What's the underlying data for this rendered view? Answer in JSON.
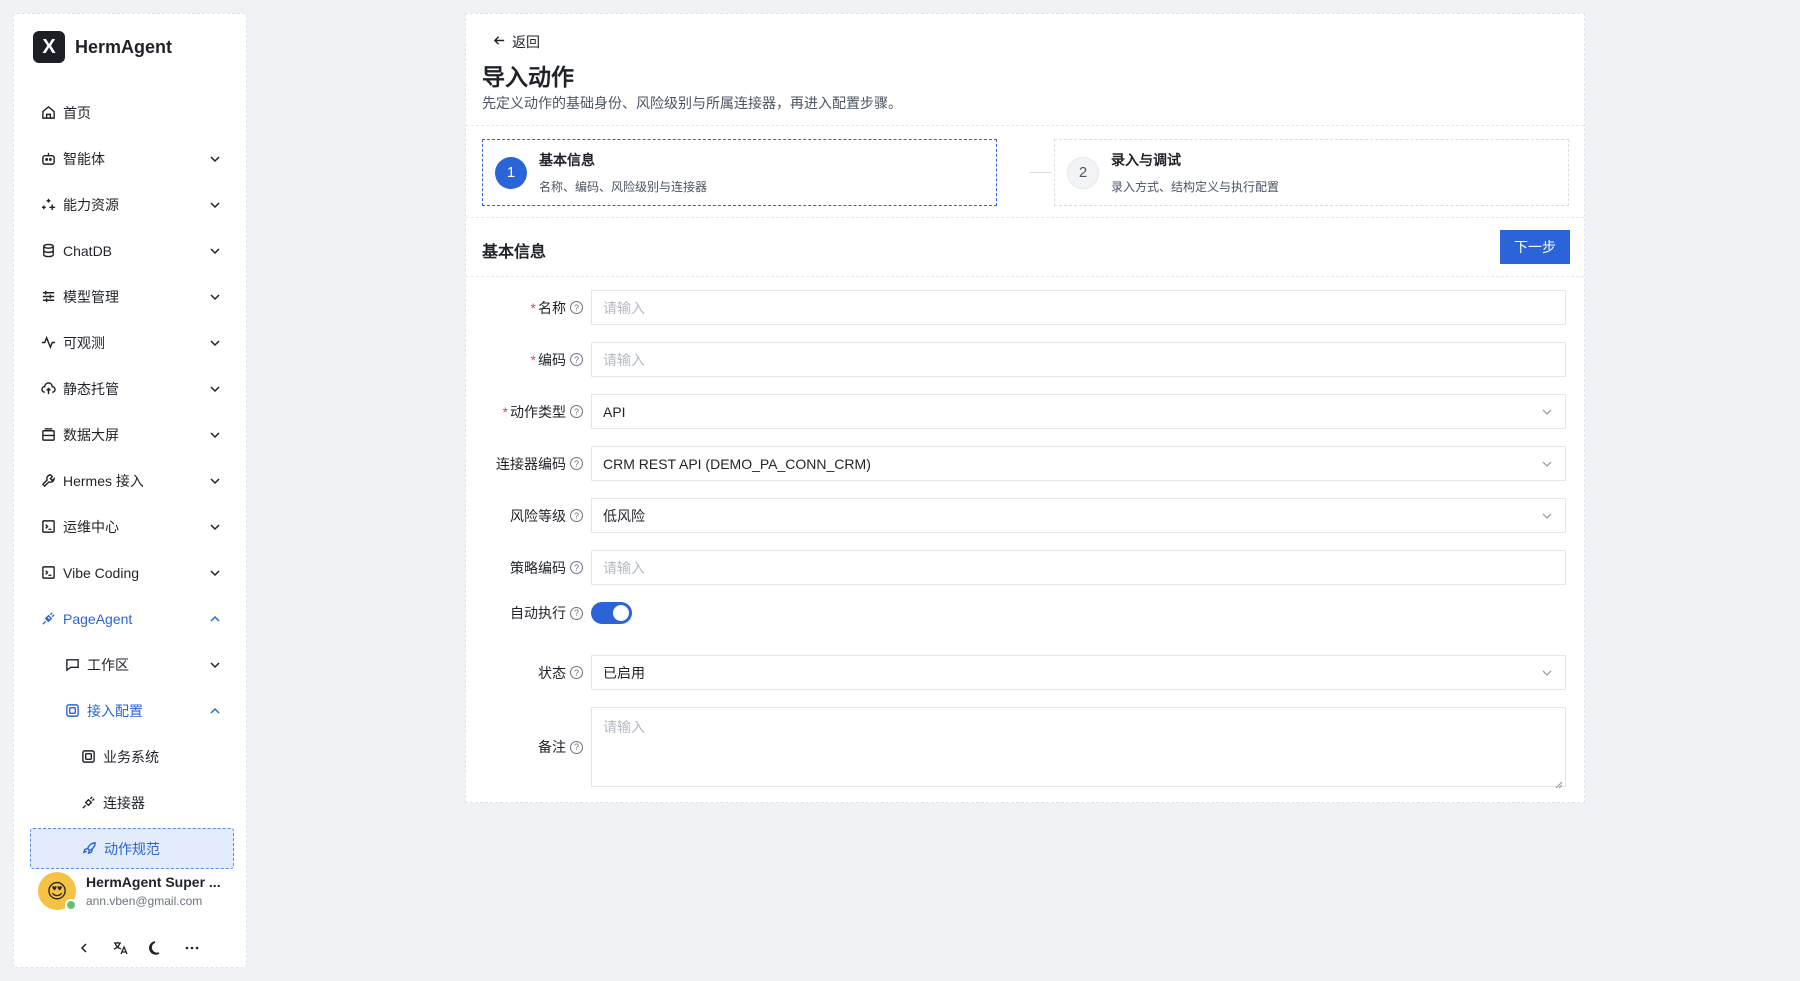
{
  "brand": {
    "logo": "X",
    "name": "HermAgent"
  },
  "sidebar": {
    "items": [
      {
        "label": "首页",
        "icon": "home-icon"
      },
      {
        "label": "智能体",
        "icon": "robot-icon"
      },
      {
        "label": "能力资源",
        "icon": "sparkles-icon"
      },
      {
        "label": "ChatDB",
        "icon": "database-icon"
      },
      {
        "label": "模型管理",
        "icon": "sliders-icon"
      },
      {
        "label": "可观测",
        "icon": "activity-icon"
      },
      {
        "label": "静态托管",
        "icon": "cloud-upload-icon"
      },
      {
        "label": "数据大屏",
        "icon": "monitor-icon"
      },
      {
        "label": "Hermes 接入",
        "icon": "wrench-icon"
      },
      {
        "label": "运维中心",
        "icon": "terminal-icon"
      },
      {
        "label": "Vibe Coding",
        "icon": "code-icon"
      },
      {
        "label": "PageAgent",
        "icon": "plug-icon"
      },
      {
        "label": "工作区",
        "icon": "chat-icon"
      },
      {
        "label": "接入配置",
        "icon": "scan-icon"
      },
      {
        "label": "业务系统",
        "icon": "scan-icon"
      },
      {
        "label": "连接器",
        "icon": "plug-icon"
      },
      {
        "label": "动作规范",
        "icon": "rocket-icon"
      }
    ]
  },
  "user": {
    "name": "HermAgent Super ...",
    "email": "ann.vben@gmail.com"
  },
  "page": {
    "back": "返回",
    "title": "导入动作",
    "description": "先定义动作的基础身份、风险级别与所属连接器，再进入配置步骤。"
  },
  "steps": [
    {
      "num": "1",
      "title": "基本信息",
      "subtitle": "名称、编码、风险级别与连接器"
    },
    {
      "num": "2",
      "title": "录入与调试",
      "subtitle": "录入方式、结构定义与执行配置"
    }
  ],
  "section": {
    "title": "基本信息",
    "next": "下一步"
  },
  "form": {
    "name": {
      "label": "名称",
      "placeholder": "请输入"
    },
    "code": {
      "label": "编码",
      "placeholder": "请输入"
    },
    "action_type": {
      "label": "动作类型",
      "value": "API"
    },
    "connector_code": {
      "label": "连接器编码",
      "value": "CRM REST API (DEMO_PA_CONN_CRM)"
    },
    "risk_level": {
      "label": "风险等级",
      "value": "低风险"
    },
    "policy_code": {
      "label": "策略编码",
      "placeholder": "请输入"
    },
    "auto_exec": {
      "label": "自动执行",
      "on": true
    },
    "status": {
      "label": "状态",
      "value": "已启用"
    },
    "remark": {
      "label": "备注",
      "placeholder": "请输入"
    }
  },
  "colors": {
    "primary": "#2b64d8",
    "required": "#e04646"
  }
}
